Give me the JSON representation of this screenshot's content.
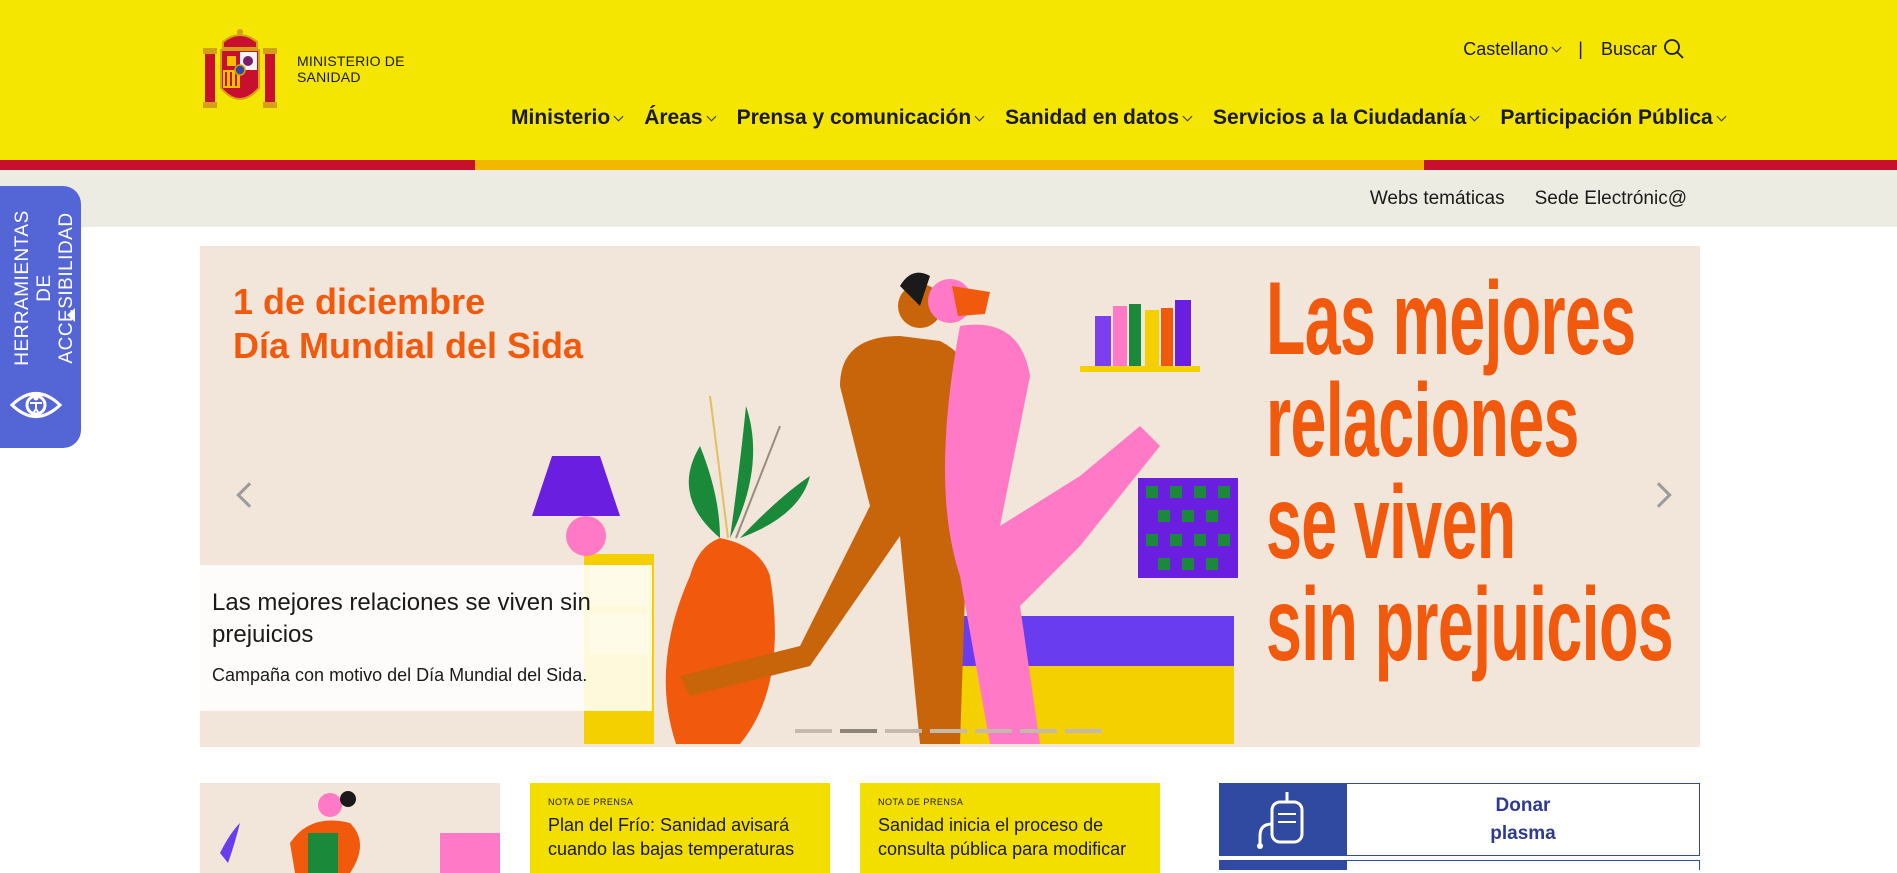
{
  "header": {
    "logo_text": "MINISTERIO DE SANIDAD",
    "language": "Castellano",
    "separator": "|",
    "search_label": "Buscar",
    "nav": [
      "Ministerio",
      "Áreas",
      "Prensa y comunicación",
      "Sanidad en datos",
      "Servicios a la Ciudadanía",
      "Participación Pública"
    ]
  },
  "subbar": {
    "links": [
      "Webs temáticas",
      "Sede Electrónic@"
    ]
  },
  "accessibility": {
    "label": "HERRAMIENTAS DE ACCESIBILIDAD"
  },
  "hero": {
    "date_line1": "1 de diciembre",
    "date_line2": "Día Mundial del Sida",
    "big_lines": [
      "Las mejores",
      "relaciones",
      "se viven",
      "sin prejuicios"
    ],
    "caption_title": "Las mejores relaciones se viven sin prejuicios",
    "caption_subtitle": "Campaña con motivo del Día Mundial del Sida.",
    "slide_count": 7,
    "active_slide": 2
  },
  "cards": [
    {
      "kicker": "NOTA DE PRENSA",
      "title": "Plan del Frío: Sanidad avisará cuando las bajas temperaturas"
    },
    {
      "kicker": "NOTA DE PRENSA",
      "title": "Sanidad inicia el proceso de consulta pública para modificar"
    }
  ],
  "donar": {
    "label_line1": "Donar",
    "label_line2": "plasma"
  },
  "colors": {
    "header_yellow": "#f4e600",
    "stripe_red": "#c8102e",
    "stripe_gold": "#f2b800",
    "hero_bg": "#f2e5da",
    "hero_orange": "#f15a0c",
    "accessibility_blue": "#5466d6",
    "donar_blue": "#2f4aa0"
  }
}
